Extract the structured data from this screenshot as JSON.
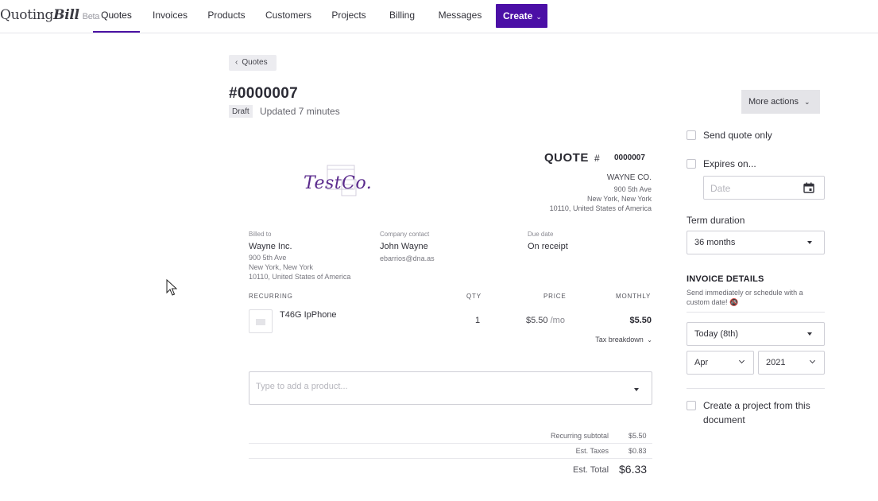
{
  "brand": {
    "name_prefix": "Quoting",
    "name_suffix": "Bill",
    "badge": "Beta"
  },
  "nav": {
    "items": [
      {
        "label": "Quotes",
        "active": true
      },
      {
        "label": "Invoices"
      },
      {
        "label": "Products"
      },
      {
        "label": "Customers"
      },
      {
        "label": "Projects"
      },
      {
        "label": "Billing"
      },
      {
        "label": "Messages"
      }
    ],
    "create_label": "Create"
  },
  "header": {
    "back_label": "Quotes",
    "doc_number": "#0000007",
    "status": "Draft",
    "updated": "Updated 7 minutes"
  },
  "document": {
    "logo_text": "TestCo.",
    "title": "QUOTE",
    "hash": "#",
    "number": "0000007",
    "company": {
      "name": "WAYNE CO.",
      "address_lines": [
        "900 5th Ave",
        "New York, New York",
        "10110, United States of America"
      ]
    },
    "billed_to": {
      "label": "Billed to",
      "name": "Wayne Inc.",
      "address_lines": [
        "900 5th Ave",
        "New York, New York",
        "10110, United States of America"
      ]
    },
    "contact": {
      "label": "Company contact",
      "name": "John Wayne",
      "email": "ebarrios@dna.as"
    },
    "due": {
      "label": "Due date",
      "value": "On receipt"
    },
    "columns": {
      "section": "RECURRING",
      "qty": "QTY",
      "price": "PRICE",
      "monthly": "MONTHLY"
    },
    "line_items": [
      {
        "name": "T46G IpPhone",
        "qty": "1",
        "price": "$5.50",
        "price_unit": "/mo",
        "monthly": "$5.50"
      }
    ],
    "tax_breakdown_label": "Tax breakdown",
    "product_input_placeholder": "Type to add a product...",
    "totals": {
      "subtotal_label": "Recurring subtotal",
      "subtotal": "$5.50",
      "taxes_label": "Est. Taxes",
      "taxes": "$0.83",
      "total_label": "Est. Total",
      "total": "$6.33"
    }
  },
  "sidebar": {
    "more_actions_label": "More actions",
    "send_quote_only_label": "Send quote only",
    "expires_label": "Expires on...",
    "date_placeholder": "Date",
    "term_label": "Term duration",
    "term_value": "36 months",
    "invoice_details_title": "INVOICE DETAILS",
    "invoice_details_desc": "Send immediately or schedule with a custom date! 🚳",
    "schedule_day": "Today (8th)",
    "schedule_month": "Apr",
    "schedule_year": "2021",
    "create_project_label": "Create a project from this document"
  },
  "colors": {
    "accent": "#4b0fa6",
    "logo": "#5a2a8c"
  }
}
